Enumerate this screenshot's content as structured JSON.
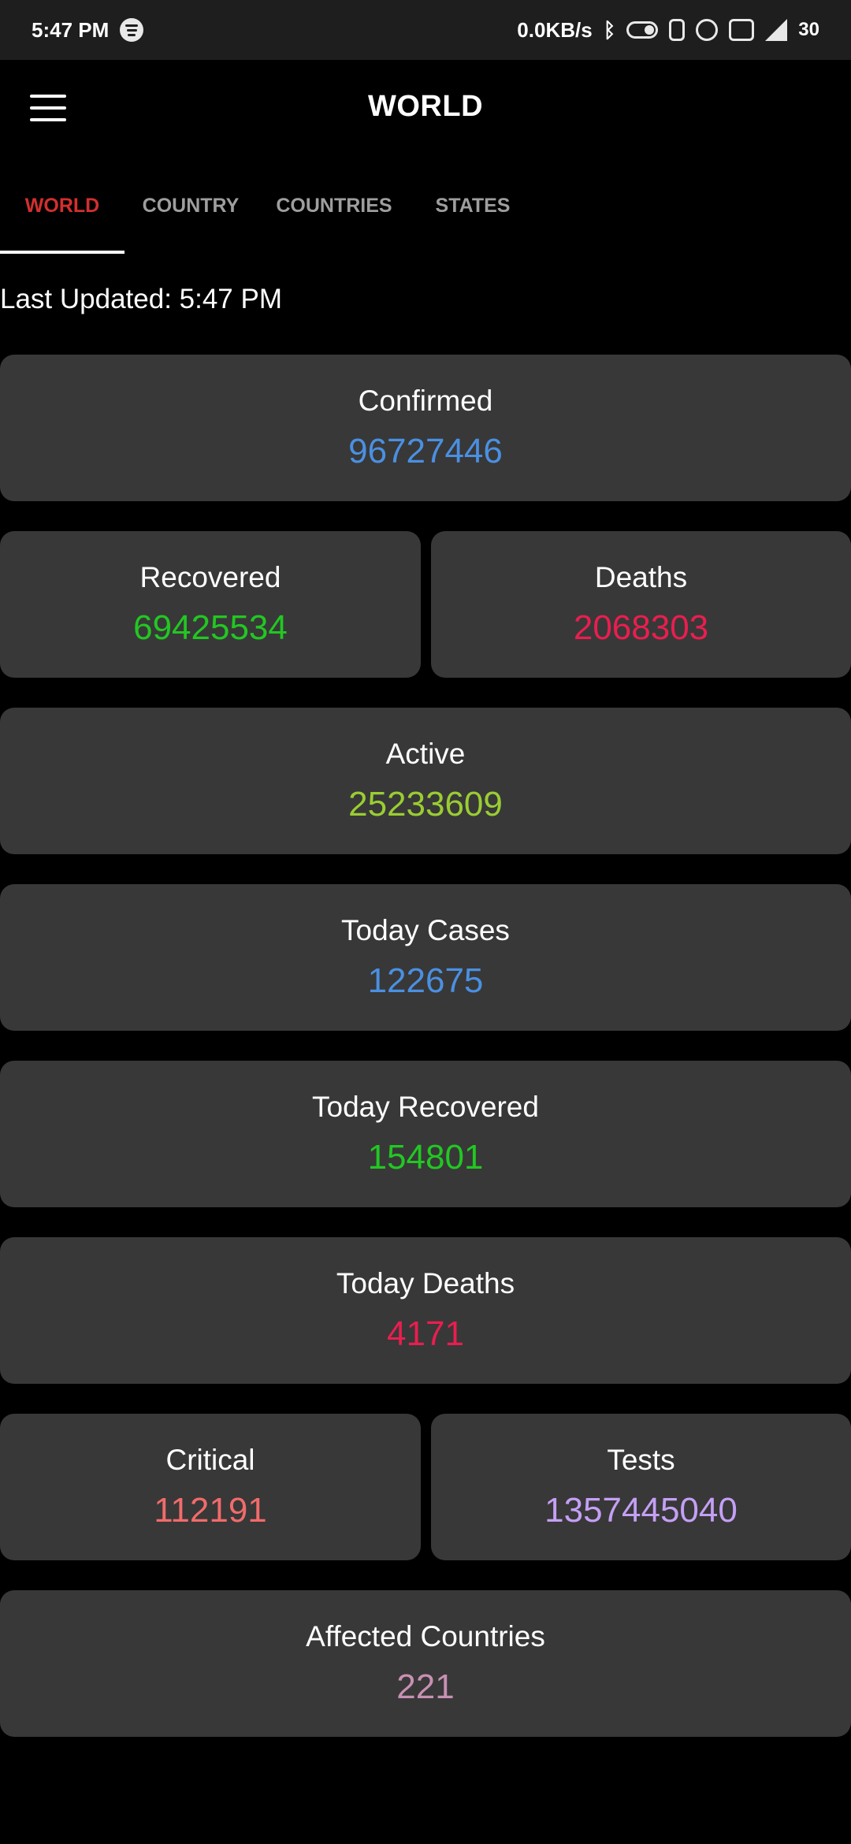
{
  "status_bar": {
    "time": "5:47 PM",
    "speed": "0.0KB/s",
    "battery": "30",
    "icons": [
      "spotify-icon",
      "bluetooth-icon",
      "toggle-icon",
      "vibrate-icon",
      "alarm-icon",
      "volte-icon",
      "signal-icon",
      "battery-icon"
    ]
  },
  "appbar": {
    "title": "WORLD",
    "menu_icon": "hamburger-menu-icon"
  },
  "tabs": [
    {
      "label": "WORLD",
      "active": true
    },
    {
      "label": "COUNTRY",
      "active": false
    },
    {
      "label": "COUNTRIES",
      "active": false
    },
    {
      "label": "STATES",
      "active": false
    }
  ],
  "colors": {
    "active_tab": "#d32f2f",
    "confirmed": "#4a90e2",
    "recovered": "#22c722",
    "deaths": "#e91e4f",
    "active": "#9acd32",
    "today_cases": "#4a90e2",
    "today_recovered": "#22c722",
    "today_deaths": "#e91e4f",
    "critical": "#f26b6b",
    "tests": "#c4a0f5",
    "affected": "#c890b4"
  },
  "last_updated": "Last Updated: 5:47 PM",
  "stats": {
    "confirmed": {
      "label": "Confirmed",
      "value": "96727446"
    },
    "recovered": {
      "label": "Recovered",
      "value": "69425534"
    },
    "deaths": {
      "label": "Deaths",
      "value": "2068303"
    },
    "active": {
      "label": "Active",
      "value": "25233609"
    },
    "today_cases": {
      "label": "Today Cases",
      "value": "122675"
    },
    "today_recovered": {
      "label": "Today Recovered",
      "value": "154801"
    },
    "today_deaths": {
      "label": "Today Deaths",
      "value": "4171"
    },
    "critical": {
      "label": "Critical",
      "value": "112191"
    },
    "tests": {
      "label": "Tests",
      "value": "1357445040"
    },
    "affected_countries": {
      "label": "Affected Countries",
      "value": "221"
    }
  }
}
